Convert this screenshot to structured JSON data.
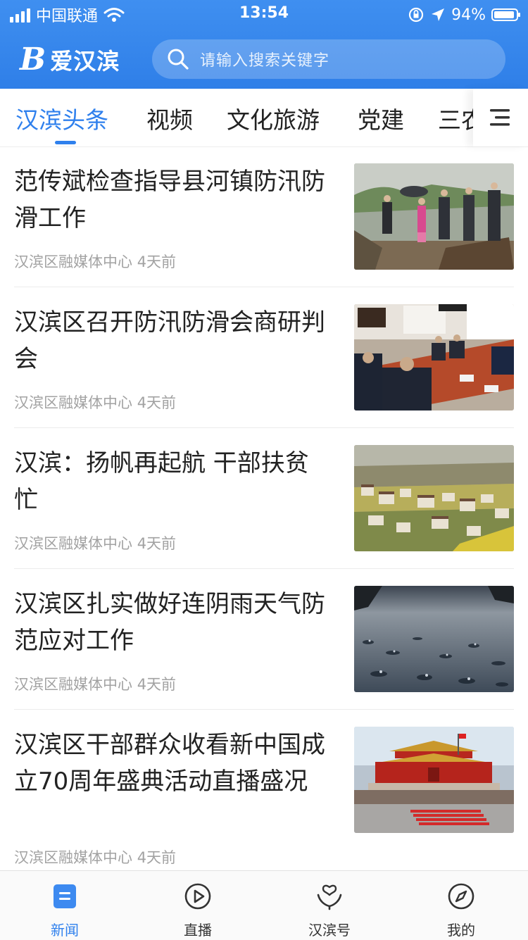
{
  "status_bar": {
    "carrier": "中国联通",
    "time": "13:54",
    "battery": "94%",
    "battery_level": 0.94
  },
  "header": {
    "brand_logo": "B",
    "brand_name": "爱汉滨",
    "search_placeholder": "请输入搜索关键字"
  },
  "tabs": [
    {
      "label": "汉滨头条",
      "active": true
    },
    {
      "label": "视频"
    },
    {
      "label": "文化旅游"
    },
    {
      "label": "党建"
    },
    {
      "label": "三农"
    }
  ],
  "news": [
    {
      "title": "范传斌检查指导县河镇防汛防滑工作",
      "source": "汉滨区融媒体中心",
      "time": "4天前",
      "thumb": "inspection-photo"
    },
    {
      "title": "汉滨区召开防汛防滑会商研判会",
      "source": "汉滨区融媒体中心",
      "time": "4天前",
      "thumb": "meeting-photo"
    },
    {
      "title": "汉滨：扬帆再起航 干部扶贫忙",
      "source": "汉滨区融媒体中心",
      "time": "4天前",
      "thumb": "village-photo"
    },
    {
      "title": "汉滨区扎实做好连阴雨天气防范应对工作",
      "source": "汉滨区融媒体中心",
      "time": "4天前",
      "thumb": "rain-photo"
    },
    {
      "title": "汉滨区干部群众收看新中国成立70周年盛典活动直播盛况",
      "source": "汉滨区融媒体中心",
      "time": "4天前",
      "thumb": "parade-photo"
    }
  ],
  "bottom_nav": [
    {
      "label": "新闻",
      "icon": "news-icon",
      "active": true
    },
    {
      "label": "直播",
      "icon": "play-icon"
    },
    {
      "label": "汉滨号",
      "icon": "heart-hand-icon"
    },
    {
      "label": "我的",
      "icon": "compass-icon"
    }
  ],
  "colors": {
    "brand_blue": "#2f80ed",
    "header_blue": "#3f8ff0",
    "meta_gray": "#a2a2a2"
  }
}
